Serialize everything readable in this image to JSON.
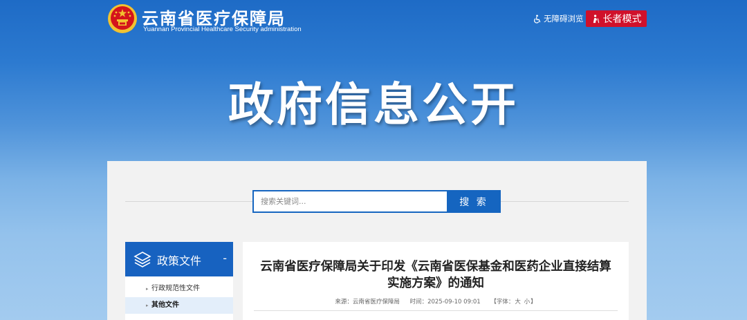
{
  "header": {
    "site_title": "云南省医疗保障局",
    "site_subtitle": "Yuannan Provincial Healthcare Security administration",
    "accessibility_label": "无障碍浏览",
    "elder_mode_label": "长者模式"
  },
  "banner": {
    "title": "政府信息公开"
  },
  "search": {
    "placeholder": "搜索关键词...",
    "button_label": "搜 索"
  },
  "sidebar": {
    "heading": "政策文件",
    "collapse": "-",
    "items": [
      {
        "label": "行政规范性文件",
        "active": false
      },
      {
        "label": "其他文件",
        "active": true
      }
    ]
  },
  "article": {
    "title": "云南省医疗保障局关于印发《云南省医保基金和医药企业直接结算实施方案》的通知",
    "source_label": "来源：云南省医疗保障局",
    "time_label": "时间：2025-09-10 09:01",
    "font_label": "【字体：",
    "font_large": "大",
    "font_small": "小",
    "font_close": "】"
  },
  "colors": {
    "primary_blue": "#1565c0",
    "elder_red": "#d0112b",
    "emblem_red": "#d4141c",
    "emblem_gold": "#f2c230"
  },
  "icons": {
    "emblem": "national-emblem-icon",
    "accessibility": "wheelchair-icon",
    "elder": "elder-person-icon",
    "sidebar": "layers-stack-icon"
  }
}
